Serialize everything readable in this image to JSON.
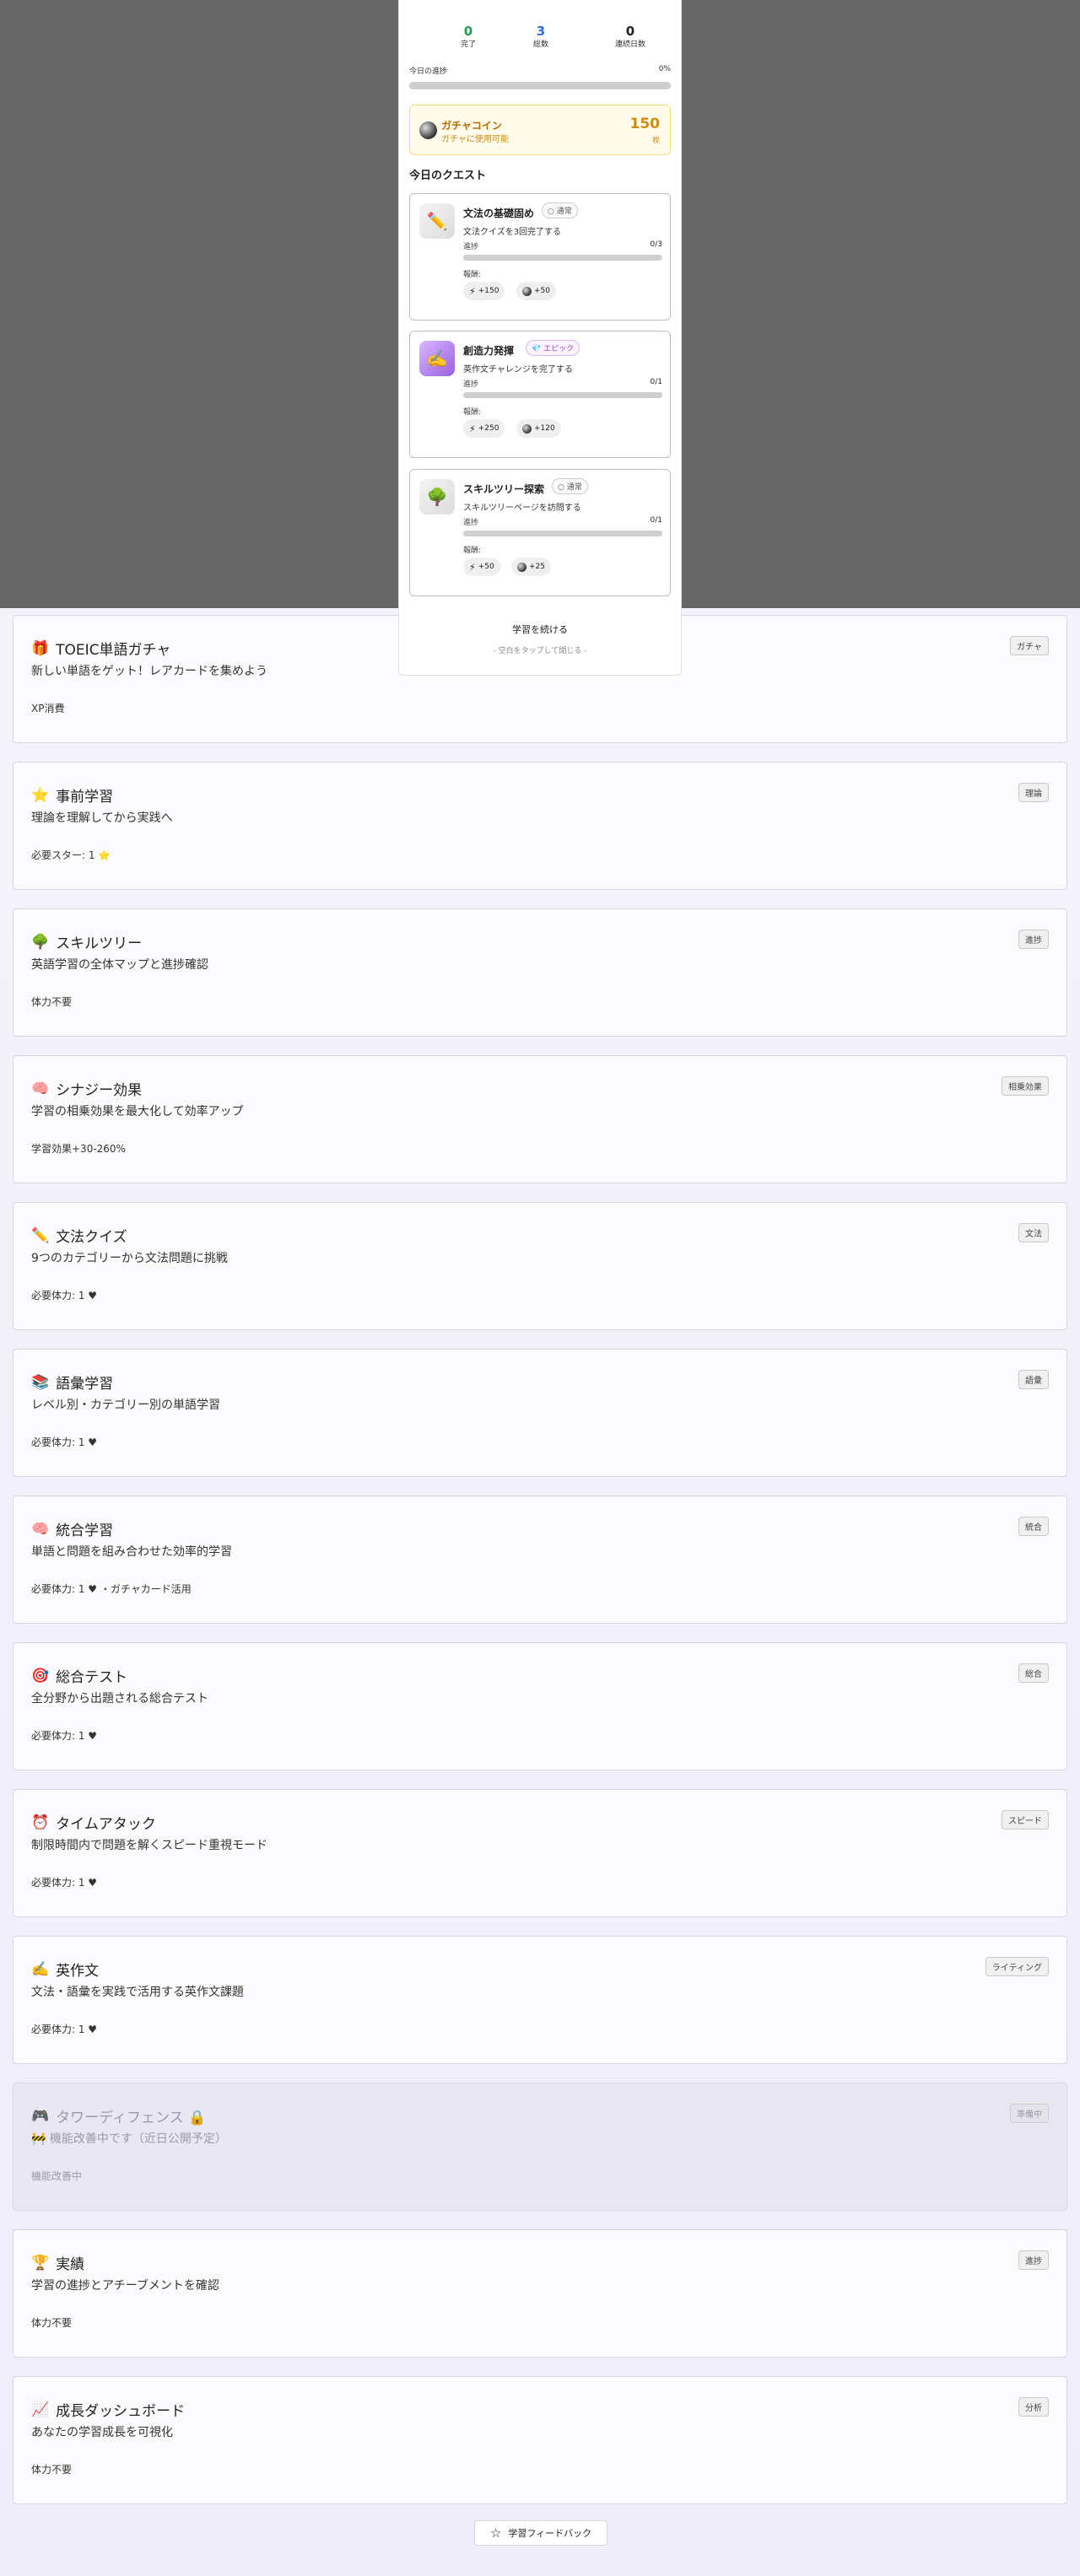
{
  "modal": {
    "stats": [
      {
        "value": "0",
        "label": "完了"
      },
      {
        "value": "3",
        "label": "総数"
      },
      {
        "value": "0",
        "label": "連続日数"
      }
    ],
    "progress": {
      "label": "今日の進捗",
      "value_text": "0%",
      "fraction": 0
    },
    "coin": {
      "title": "ガチャコイン",
      "subtitle": "ガチャに使用可能",
      "amount": "150",
      "unit": "枚"
    },
    "quests_heading": "今日のクエスト",
    "quests": [
      {
        "icon": "✏️",
        "name": "文法の基礎固め",
        "rarity": "○ 通常",
        "desc": "文法クイズを3回完了する",
        "progress_label": "進捗",
        "progress_text": "0/3",
        "progress_fraction": 0,
        "rewards_label": "報酬:",
        "xp": "+150",
        "coins": "+50"
      },
      {
        "icon": "✍️",
        "name": "創造力発揮",
        "rarity": "💎 エピック",
        "desc": "英作文チャレンジを完了する",
        "progress_label": "進捗",
        "progress_text": "0/1",
        "progress_fraction": 0,
        "rewards_label": "報酬:",
        "xp": "+250",
        "coins": "+120"
      },
      {
        "icon": "🌳",
        "name": "スキルツリー探索",
        "rarity": "○ 通常",
        "desc": "スキルツリーページを訪問する",
        "progress_label": "進捗",
        "progress_text": "0/1",
        "progress_fraction": 0,
        "rewards_label": "報酬:",
        "xp": "+50",
        "coins": "+25"
      }
    ],
    "continue_label": "学習を続ける",
    "close_hint": "- 空白をタップして閉じる -"
  },
  "cards": [
    {
      "icon": "🎁",
      "title": "TOEIC単語ガチャ",
      "desc": "新しい単語をゲット！レアカードを集めよう",
      "footer": "XP消費",
      "tag": "ガチャ"
    },
    {
      "icon": "⭐",
      "title": "事前学習",
      "desc": "理論を理解してから実践へ",
      "footer": "必要スター: 1 ⭐",
      "tag": "理論"
    },
    {
      "icon": "🌳",
      "title": "スキルツリー",
      "desc": "英語学習の全体マップと進捗確認",
      "footer": "体力不要",
      "tag": "進捗"
    },
    {
      "icon": "🧠",
      "title": "シナジー効果",
      "desc": "学習の相乗効果を最大化して効率アップ",
      "footer": "学習効果+30-260%",
      "tag": "相乗効果"
    },
    {
      "icon": "✏️",
      "title": "文法クイズ",
      "desc": "9つのカテゴリーから文法問題に挑戦",
      "footer": "必要体力: 1 ♥",
      "tag": "文法"
    },
    {
      "icon": "📚",
      "title": "語彙学習",
      "desc": "レベル別・カテゴリー別の単語学習",
      "footer": "必要体力: 1 ♥",
      "tag": "語彙"
    },
    {
      "icon": "🧠",
      "title": "統合学習",
      "desc": "単語と問題を組み合わせた効率的学習",
      "footer": "必要体力: 1 ♥ ・ガチャカード活用",
      "tag": "統合"
    },
    {
      "icon": "🎯",
      "title": "総合テスト",
      "desc": "全分野から出題される総合テスト",
      "footer": "必要体力: 1 ♥",
      "tag": "総合"
    },
    {
      "icon": "⏰",
      "title": "タイムアタック",
      "desc": "制限時間内で問題を解くスピード重視モード",
      "footer": "必要体力: 1 ♥",
      "tag": "スピード"
    },
    {
      "icon": "✍️",
      "title": "英作文",
      "desc": "文法・語彙を実践で活用する英作文課題",
      "footer": "必要体力: 1 ♥",
      "tag": "ライティング"
    },
    {
      "icon": "🎮",
      "title": "タワーディフェンス 🔒",
      "desc": "🚧 機能改善中です（近日公開予定）",
      "footer": "機能改善中",
      "tag": "準備中",
      "disabled": true
    },
    {
      "icon": "🏆",
      "title": "実績",
      "desc": "学習の進捗とアチーブメントを確認",
      "footer": "体力不要",
      "tag": "進捗"
    },
    {
      "icon": "📈",
      "title": "成長ダッシュボード",
      "desc": "あなたの学習成長を可視化",
      "footer": "体力不要",
      "tag": "分析"
    }
  ],
  "feedback_label": "学習フィードバック",
  "colors": {
    "overlay": "#666666",
    "accent": "#7b6fd6",
    "coin": "#d08a10",
    "done": "#1f9e4d",
    "total": "#2f6fd6"
  }
}
